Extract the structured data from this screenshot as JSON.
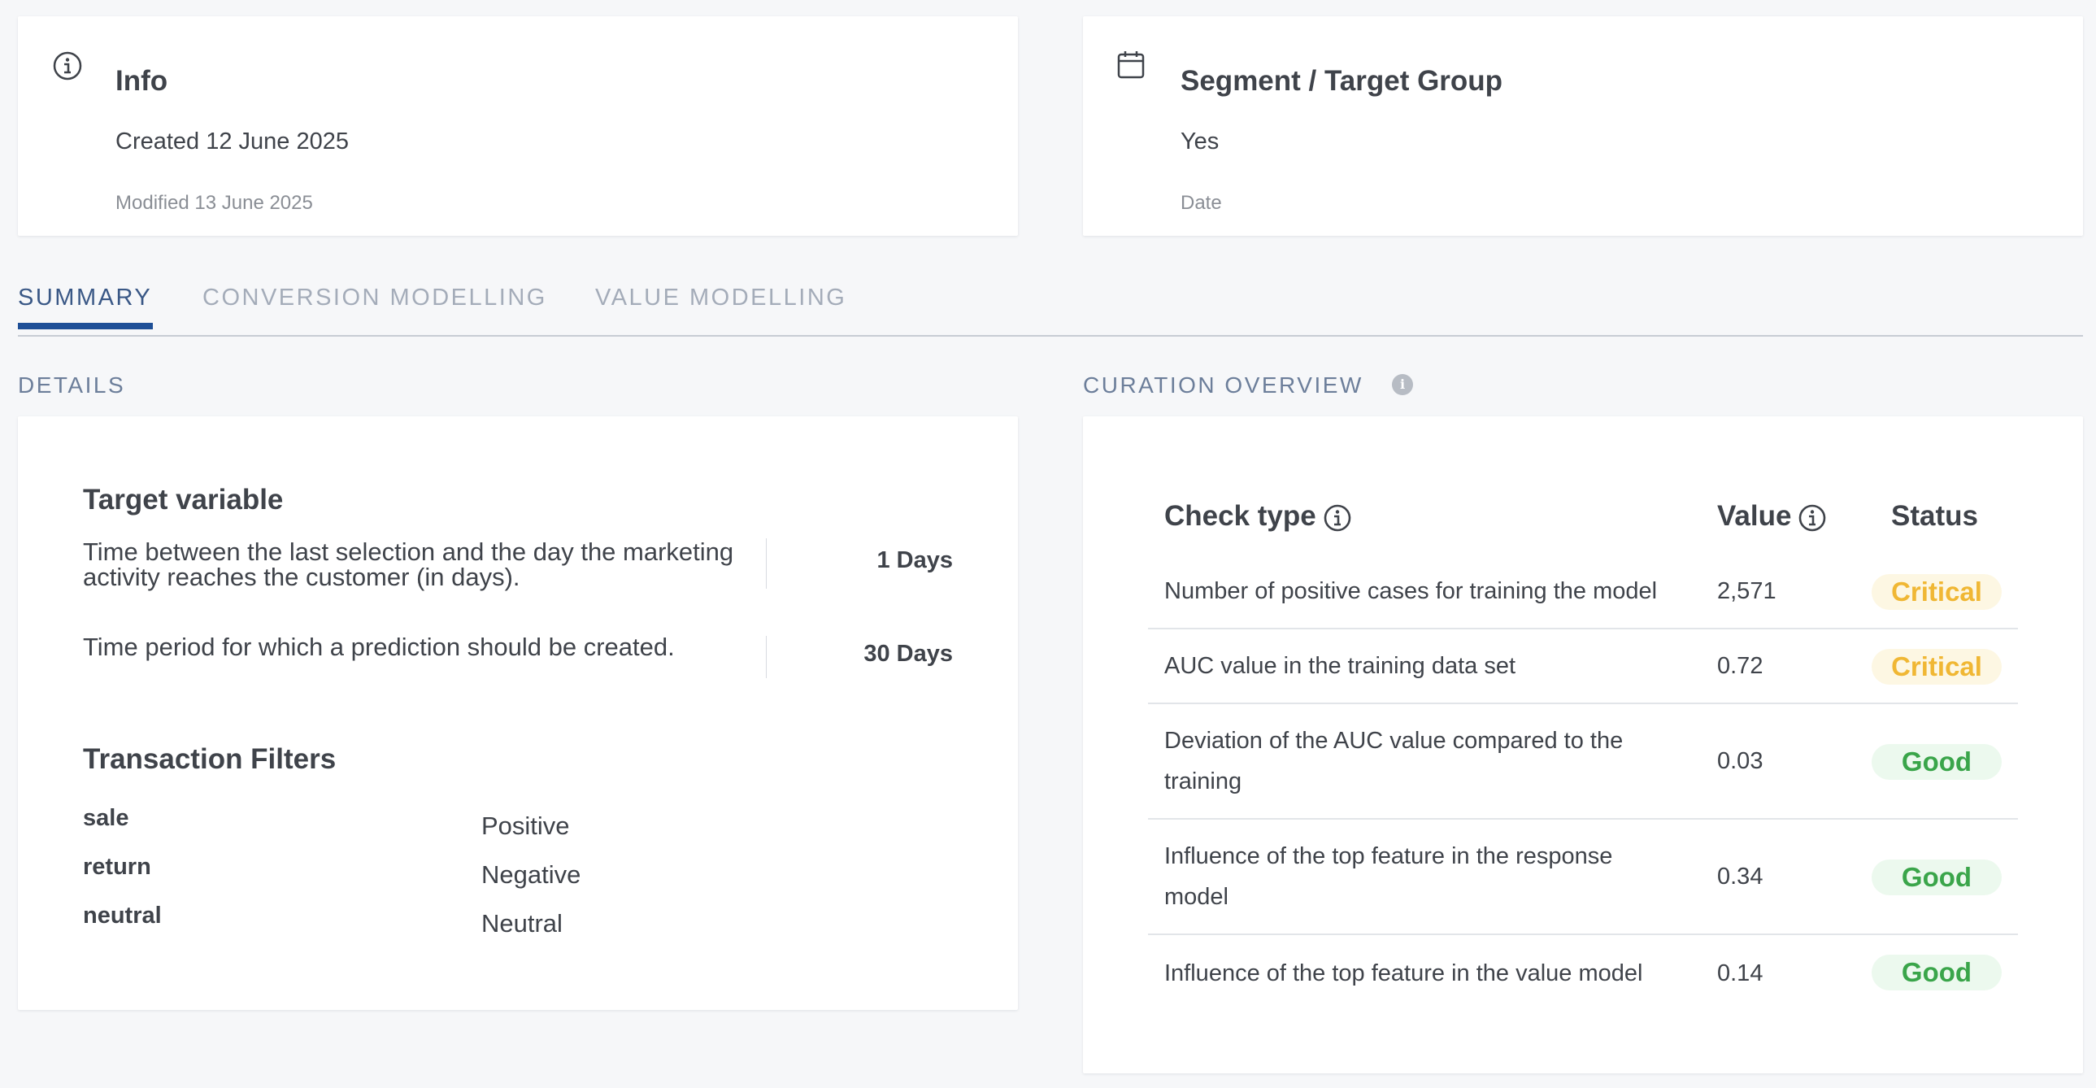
{
  "info_card": {
    "title": "Info",
    "created": "Created 12 June 2025",
    "modified": "Modified 13 June 2025",
    "icon": "info-circle-icon"
  },
  "segment_card": {
    "title": "Segment / Target Group",
    "value": "Yes",
    "meta": "Date",
    "icon": "calendar-icon"
  },
  "tabs": [
    {
      "label": "SUMMARY",
      "active": true
    },
    {
      "label": "CONVERSION MODELLING",
      "active": false
    },
    {
      "label": "VALUE MODELLING",
      "active": false
    }
  ],
  "details": {
    "section_label": "DETAILS",
    "target_variable": {
      "heading": "Target variable",
      "items": [
        {
          "text_line1": "Time between the last selection and the day the marketing",
          "text_line2": "activity reaches the customer (in days).",
          "value": "1 Days"
        },
        {
          "text_line1": "Time period for which a prediction should be created.",
          "value": "30 Days"
        }
      ]
    },
    "transaction_filters": {
      "heading": "Transaction Filters",
      "rows": [
        {
          "key": "sale",
          "value": "Positive"
        },
        {
          "key": "return",
          "value": "Negative"
        },
        {
          "key": "neutral",
          "value": "Neutral"
        }
      ]
    }
  },
  "curation": {
    "section_label": "CURATION OVERVIEW",
    "info_glyph": "i",
    "headers": {
      "check_type": "Check type",
      "value": "Value",
      "status": "Status"
    },
    "rows": [
      {
        "check_line1": "Number of positive cases for training the model",
        "check_line2": "",
        "value": "2,571",
        "status": "Critical"
      },
      {
        "check_line1": "AUC value in the training data set",
        "check_line2": "",
        "value": "0.72",
        "status": "Critical"
      },
      {
        "check_line1": "Deviation of the AUC value compared to the",
        "check_line2": "training",
        "value": "0.03",
        "status": "Good"
      },
      {
        "check_line1": "Influence of the top feature in the response",
        "check_line2": "model",
        "value": "0.34",
        "status": "Good"
      },
      {
        "check_line1": "Influence of the top feature in the value model",
        "check_line2": "",
        "value": "0.14",
        "status": "Good"
      }
    ],
    "status_colors": {
      "critical_text": "#f0b734",
      "critical_bg": "#fdf7e3",
      "good_text": "#3aa54a",
      "good_bg": "#ecf9ee"
    }
  }
}
